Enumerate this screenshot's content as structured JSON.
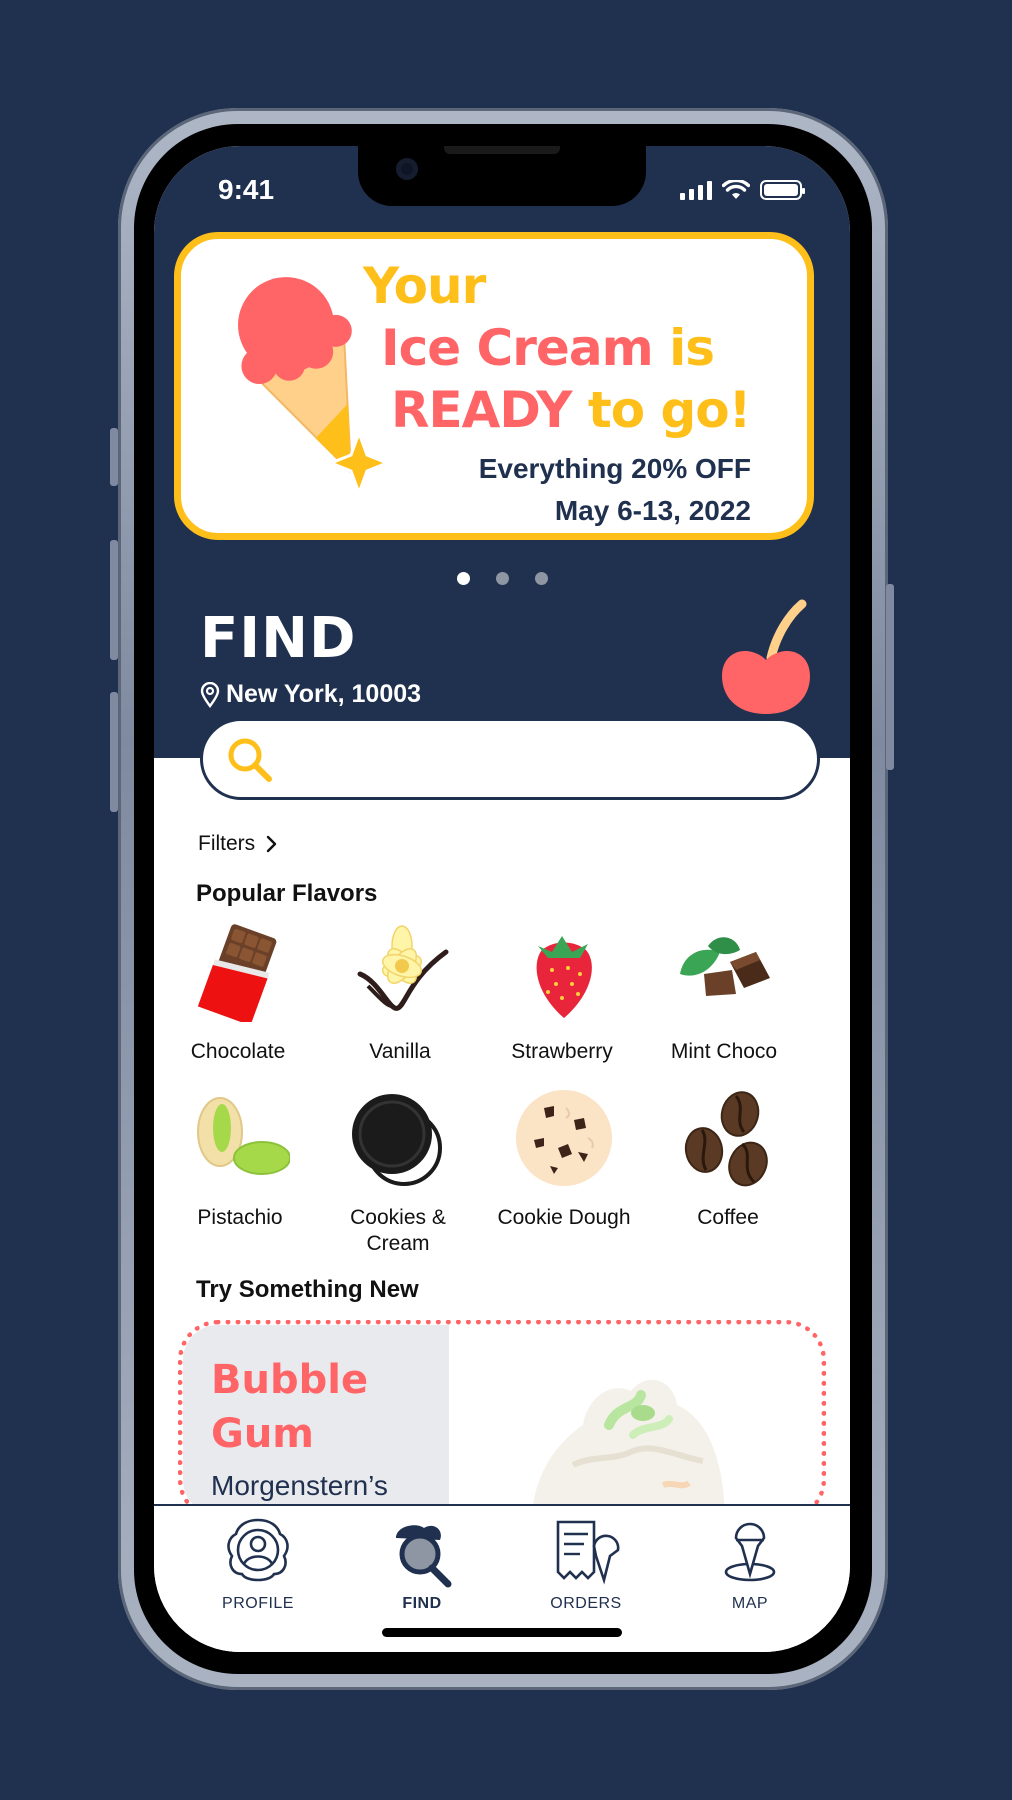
{
  "status": {
    "time": "9:41"
  },
  "banner": {
    "line1": "Your",
    "line2_a": "Ice Cream",
    "line2_b": "is",
    "line3_a": "READY",
    "line3_b": "to go!",
    "discount": "Everything 20% OFF",
    "dates": "May 6-13, 2022"
  },
  "carousel": {
    "pages": 3,
    "active": 0
  },
  "find": {
    "title": "FIND",
    "location": "New York, 10003",
    "search_placeholder": ""
  },
  "filters_label": "Filters",
  "popular": {
    "title": "Popular Flavors",
    "items": [
      {
        "label": "Chocolate",
        "icon": "chocolate-bar-icon"
      },
      {
        "label": "Vanilla",
        "icon": "vanilla-flower-icon"
      },
      {
        "label": "Strawberry",
        "icon": "strawberry-icon"
      },
      {
        "label": "Mint Choco",
        "icon": "mint-chocolate-icon"
      },
      {
        "label": "Pistachio",
        "icon": "pistachio-icon"
      },
      {
        "label": "Cookies & Cream",
        "icon": "oreo-cookie-icon"
      },
      {
        "label": "Cookie Dough",
        "icon": "cookie-dough-icon"
      },
      {
        "label": "Coffee",
        "icon": "coffee-beans-icon"
      }
    ]
  },
  "try_new": {
    "title": "Try Something New",
    "flavor": "Bubble Gum",
    "shop": "Morgenstern’s New York, NY"
  },
  "tabs": [
    {
      "label": "PROFILE",
      "icon": "profile-icon",
      "active": false
    },
    {
      "label": "FIND",
      "icon": "find-icon",
      "active": true
    },
    {
      "label": "ORDERS",
      "icon": "orders-icon",
      "active": false
    },
    {
      "label": "MAP",
      "icon": "map-pin-icon",
      "active": false
    }
  ],
  "colors": {
    "navy": "#20304f",
    "yellow": "#ffbf1a",
    "coral": "#ff6466",
    "background": "#20304f"
  }
}
